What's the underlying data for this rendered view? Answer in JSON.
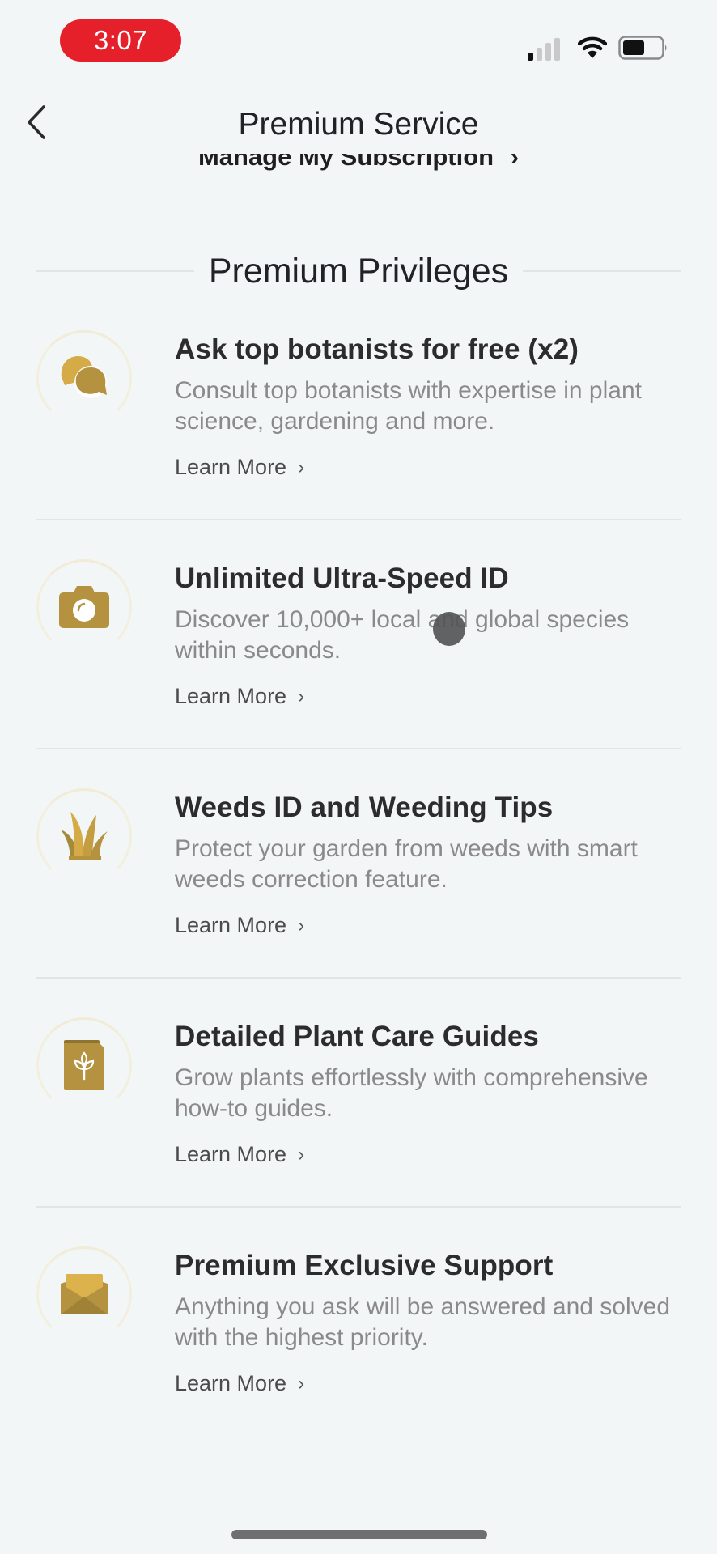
{
  "status_bar": {
    "time": "3:07",
    "signal_bars_active": 1,
    "signal_bars_total": 4,
    "wifi": "wifi-icon",
    "battery_level": 0.55
  },
  "nav": {
    "back_icon": "chevron-left-icon",
    "title": "Premium Service"
  },
  "manage_subscription": {
    "label": "Manage My Subscription",
    "chevron": "›"
  },
  "section": {
    "title": "Premium Privileges"
  },
  "colors": {
    "accent_gold": "#b4923f",
    "gold_light": "#d4ab46",
    "time_pill": "#e5202b",
    "background": "#f3f6f7"
  },
  "privileges": [
    {
      "icon": "chat-bubbles-icon",
      "title": "Ask top botanists for free (x2)",
      "description": "Consult top botanists with expertise in plant science, gardening and more.",
      "link": "Learn More",
      "link_chevron": "›"
    },
    {
      "icon": "camera-icon",
      "title": "Unlimited Ultra-Speed ID",
      "description": "Discover 10,000+ local and global species within seconds.",
      "link": "Learn More",
      "link_chevron": "›"
    },
    {
      "icon": "grass-icon",
      "title": "Weeds ID and Weeding Tips",
      "description": "Protect your garden from weeds with smart weeds correction feature.",
      "link": "Learn More",
      "link_chevron": "›"
    },
    {
      "icon": "plant-book-icon",
      "title": "Detailed Plant Care Guides",
      "description": "Grow plants effortlessly with comprehensive how-to guides.",
      "link": "Learn More",
      "link_chevron": "›"
    },
    {
      "icon": "envelope-icon",
      "title": "Premium Exclusive Support",
      "description": "Anything you ask will be answered and solved with the highest priority.",
      "link": "Learn More",
      "link_chevron": "›"
    }
  ]
}
